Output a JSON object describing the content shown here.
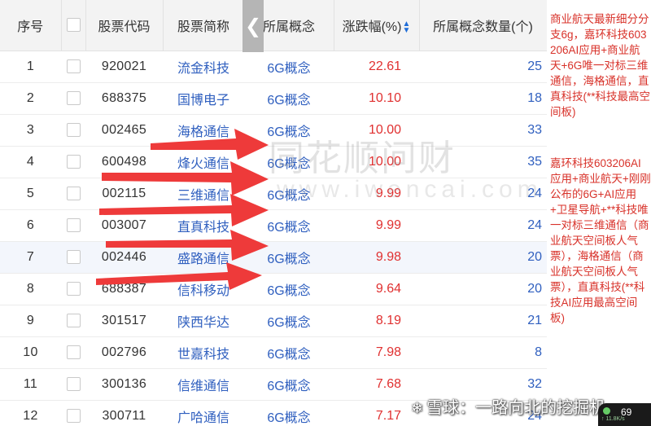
{
  "table": {
    "headers": {
      "seq": "序号",
      "code": "股票代码",
      "name": "股票简称",
      "concept": "所属概念",
      "change": "涨跌幅(%)",
      "concept_count": "所属概念数量(个)"
    },
    "rows": [
      {
        "seq": "1",
        "code": "920021",
        "name": "流金科技",
        "concept": "6G概念",
        "change": "22.61",
        "count": "25"
      },
      {
        "seq": "2",
        "code": "688375",
        "name": "国博电子",
        "concept": "6G概念",
        "change": "10.10",
        "count": "18"
      },
      {
        "seq": "3",
        "code": "002465",
        "name": "海格通信",
        "concept": "6G概念",
        "change": "10.00",
        "count": "33"
      },
      {
        "seq": "4",
        "code": "600498",
        "name": "烽火通信",
        "concept": "6G概念",
        "change": "10.00",
        "count": "35"
      },
      {
        "seq": "5",
        "code": "002115",
        "name": "三维通信",
        "concept": "6G概念",
        "change": "9.99",
        "count": "24"
      },
      {
        "seq": "6",
        "code": "003007",
        "name": "直真科技",
        "concept": "6G概念",
        "change": "9.99",
        "count": "24"
      },
      {
        "seq": "7",
        "code": "002446",
        "name": "盛路通信",
        "concept": "6G概念",
        "change": "9.98",
        "count": "20"
      },
      {
        "seq": "8",
        "code": "688387",
        "name": "信科移动",
        "concept": "6G概念",
        "change": "9.64",
        "count": "20"
      },
      {
        "seq": "9",
        "code": "301517",
        "name": "陕西华达",
        "concept": "6G概念",
        "change": "8.19",
        "count": "21"
      },
      {
        "seq": "10",
        "code": "002796",
        "name": "世嘉科技",
        "concept": "6G概念",
        "change": "7.98",
        "count": "8"
      },
      {
        "seq": "11",
        "code": "300136",
        "name": "信维通信",
        "concept": "6G概念",
        "change": "7.68",
        "count": "32"
      },
      {
        "seq": "12",
        "code": "300711",
        "name": "广哈通信",
        "concept": "6G概念",
        "change": "7.17",
        "count": "24"
      }
    ]
  },
  "notes": {
    "note1": "商业航天最新细分分支6g，嘉环科技603206AI应用+商业航天+6G唯一对标三维通信，海格通信，直真科技(**科技最高空间板)",
    "note2": "嘉环科技603206AI应用+商业航天+刚刚公布的6G+AI应用+卫星导航+**科技唯一对标三维通信（商业航天空间板人气票），海格通信（商业航天空间板人气票），直真科技(**科技AI应用最高空间板)"
  },
  "watermark": {
    "brand": "同花顺问财",
    "url": "www.iwencai.com",
    "footer": "雪球：一路向北的挖掘机"
  },
  "speed_widget": {
    "value": "69",
    "sub": "↑ 11.8K/s"
  },
  "icons": {
    "nav": "chevron-left-icon",
    "sort": "sort-icon",
    "annotation": "red-arrow-icon",
    "footer_logo": "snowball-logo-icon"
  },
  "colors": {
    "link": "#2f5fbf",
    "change": "#e03030",
    "note": "#d8322a",
    "arrow": "#ee3a3a",
    "header_bg": "#f3f3f3"
  }
}
